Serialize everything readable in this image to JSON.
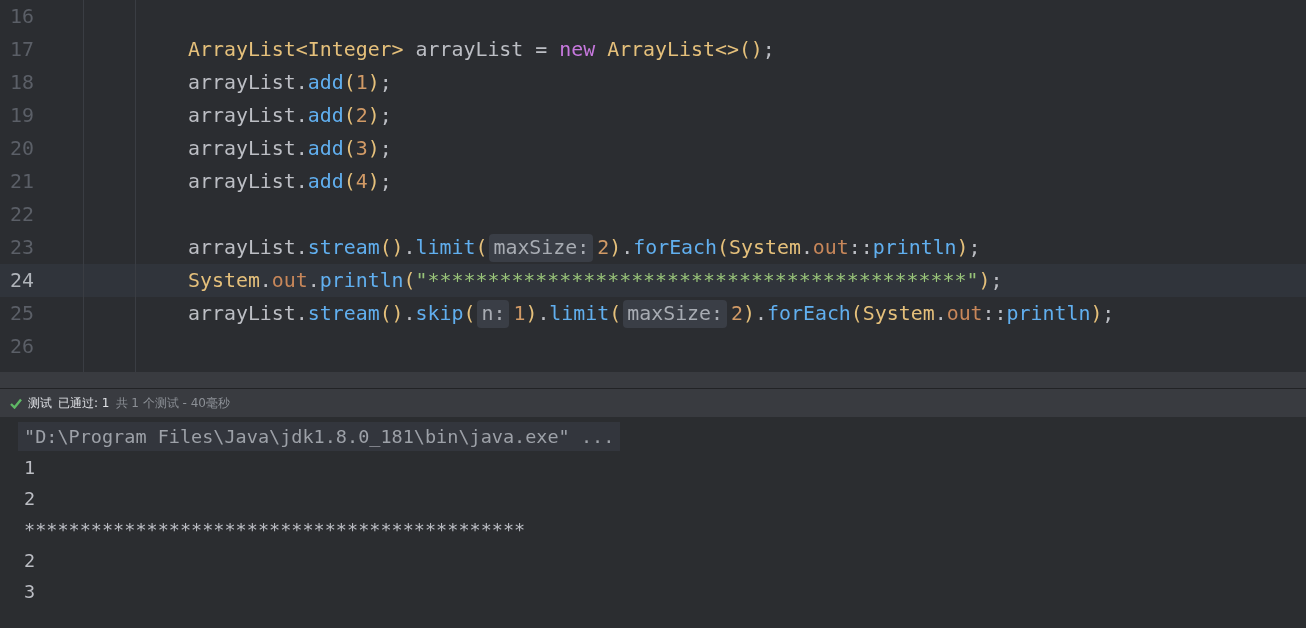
{
  "editor": {
    "lines": [
      {
        "number": "16",
        "current": false
      },
      {
        "number": "17",
        "current": false,
        "segments": [
          {
            "kind": "code",
            "tokens": [
              {
                "t": "ArrayList<Integer>",
                "color": "#e5c07b"
              },
              {
                "t": " arrayList = ",
                "color": "#bcbec4"
              },
              {
                "t": "new",
                "color": "#c678dd"
              },
              {
                "t": " ArrayList<>",
                "color": "#e5c07b"
              },
              {
                "t": "()",
                "color": "#e5c07b"
              },
              {
                "t": ";",
                "color": "#bcbec4"
              }
            ]
          }
        ]
      },
      {
        "number": "18",
        "current": false,
        "segments": [
          {
            "kind": "code",
            "tokens": [
              {
                "t": "arrayList.",
                "color": "#bcbec4"
              },
              {
                "t": "add",
                "color": "#61afef"
              },
              {
                "t": "(",
                "color": "#e5c07b"
              },
              {
                "t": "1",
                "color": "#d19a66"
              },
              {
                "t": ")",
                "color": "#e5c07b"
              },
              {
                "t": ";",
                "color": "#bcbec4"
              }
            ]
          }
        ]
      },
      {
        "number": "19",
        "current": false,
        "segments": [
          {
            "kind": "code",
            "tokens": [
              {
                "t": "arrayList.",
                "color": "#bcbec4"
              },
              {
                "t": "add",
                "color": "#61afef"
              },
              {
                "t": "(",
                "color": "#e5c07b"
              },
              {
                "t": "2",
                "color": "#d19a66"
              },
              {
                "t": ")",
                "color": "#e5c07b"
              },
              {
                "t": ";",
                "color": "#bcbec4"
              }
            ]
          }
        ]
      },
      {
        "number": "20",
        "current": false,
        "segments": [
          {
            "kind": "code",
            "tokens": [
              {
                "t": "arrayList.",
                "color": "#bcbec4"
              },
              {
                "t": "add",
                "color": "#61afef"
              },
              {
                "t": "(",
                "color": "#e5c07b"
              },
              {
                "t": "3",
                "color": "#d19a66"
              },
              {
                "t": ")",
                "color": "#e5c07b"
              },
              {
                "t": ";",
                "color": "#bcbec4"
              }
            ]
          }
        ]
      },
      {
        "number": "21",
        "current": false,
        "segments": [
          {
            "kind": "code",
            "tokens": [
              {
                "t": "arrayList.",
                "color": "#bcbec4"
              },
              {
                "t": "add",
                "color": "#61afef"
              },
              {
                "t": "(",
                "color": "#e5c07b"
              },
              {
                "t": "4",
                "color": "#d19a66"
              },
              {
                "t": ")",
                "color": "#e5c07b"
              },
              {
                "t": ";",
                "color": "#bcbec4"
              }
            ]
          }
        ]
      },
      {
        "number": "22",
        "current": false
      },
      {
        "number": "23",
        "current": false,
        "segments": [
          {
            "kind": "code",
            "tokens": [
              {
                "t": "arrayList.",
                "color": "#bcbec4"
              },
              {
                "t": "stream",
                "color": "#61afef"
              },
              {
                "t": "()",
                "color": "#e5c07b"
              },
              {
                "t": ".",
                "color": "#bcbec4"
              },
              {
                "t": "limit",
                "color": "#61afef"
              },
              {
                "t": "(",
                "color": "#e5c07b"
              }
            ]
          },
          {
            "kind": "hint",
            "text": "maxSize:"
          },
          {
            "kind": "code",
            "tokens": [
              {
                "t": "2",
                "color": "#d19a66"
              },
              {
                "t": ")",
                "color": "#e5c07b"
              },
              {
                "t": ".",
                "color": "#bcbec4"
              },
              {
                "t": "forEach",
                "color": "#61afef"
              },
              {
                "t": "(",
                "color": "#e5c07b"
              },
              {
                "t": "System",
                "color": "#e5c07b"
              },
              {
                "t": ".",
                "color": "#bcbec4"
              },
              {
                "t": "out",
                "color": "#c8875a"
              },
              {
                "t": "::",
                "color": "#bcbec4"
              },
              {
                "t": "println",
                "color": "#61afef"
              },
              {
                "t": ")",
                "color": "#e5c07b"
              },
              {
                "t": ";",
                "color": "#bcbec4"
              }
            ]
          }
        ]
      },
      {
        "number": "24",
        "current": true,
        "segments": [
          {
            "kind": "code",
            "tokens": [
              {
                "t": "System",
                "color": "#e5c07b"
              },
              {
                "t": ".",
                "color": "#bcbec4"
              },
              {
                "t": "out",
                "color": "#c8875a"
              },
              {
                "t": ".",
                "color": "#bcbec4"
              },
              {
                "t": "println",
                "color": "#61afef"
              },
              {
                "t": "(",
                "color": "#e5c07b"
              },
              {
                "t": "\"*********************************************\"",
                "color": "#98c379"
              },
              {
                "t": ")",
                "color": "#e5c07b"
              },
              {
                "t": ";",
                "color": "#bcbec4"
              }
            ]
          }
        ]
      },
      {
        "number": "25",
        "current": false,
        "segments": [
          {
            "kind": "code",
            "tokens": [
              {
                "t": "arrayList.",
                "color": "#bcbec4"
              },
              {
                "t": "stream",
                "color": "#61afef"
              },
              {
                "t": "()",
                "color": "#e5c07b"
              },
              {
                "t": ".",
                "color": "#bcbec4"
              },
              {
                "t": "skip",
                "color": "#61afef"
              },
              {
                "t": "(",
                "color": "#e5c07b"
              }
            ]
          },
          {
            "kind": "hint",
            "text": "n:"
          },
          {
            "kind": "code",
            "tokens": [
              {
                "t": "1",
                "color": "#d19a66"
              },
              {
                "t": ")",
                "color": "#e5c07b"
              },
              {
                "t": ".",
                "color": "#bcbec4"
              },
              {
                "t": "limit",
                "color": "#61afef"
              },
              {
                "t": "(",
                "color": "#e5c07b"
              }
            ]
          },
          {
            "kind": "hint",
            "text": "maxSize:"
          },
          {
            "kind": "code",
            "tokens": [
              {
                "t": "2",
                "color": "#d19a66"
              },
              {
                "t": ")",
                "color": "#e5c07b"
              },
              {
                "t": ".",
                "color": "#bcbec4"
              },
              {
                "t": "forEach",
                "color": "#61afef"
              },
              {
                "t": "(",
                "color": "#e5c07b"
              },
              {
                "t": "System",
                "color": "#e5c07b"
              },
              {
                "t": ".",
                "color": "#bcbec4"
              },
              {
                "t": "out",
                "color": "#c8875a"
              },
              {
                "t": "::",
                "color": "#bcbec4"
              },
              {
                "t": "println",
                "color": "#61afef"
              },
              {
                "t": ")",
                "color": "#e5c07b"
              },
              {
                "t": ";",
                "color": "#bcbec4"
              }
            ]
          }
        ]
      },
      {
        "number": "26",
        "current": false
      }
    ]
  },
  "test_status": {
    "passed": true,
    "label": "测试",
    "result": "已通过: 1",
    "summary": "共 1 个测试 - 40毫秒"
  },
  "console": {
    "lines": [
      {
        "text": "\"D:\\Program Files\\Java\\jdk1.8.0_181\\bin\\java.exe\" ...",
        "kind": "command"
      },
      {
        "text": "1",
        "kind": "output"
      },
      {
        "text": "2",
        "kind": "output"
      },
      {
        "text": "*********************************************",
        "kind": "output"
      },
      {
        "text": "2",
        "kind": "output"
      },
      {
        "text": "3",
        "kind": "output"
      }
    ]
  }
}
